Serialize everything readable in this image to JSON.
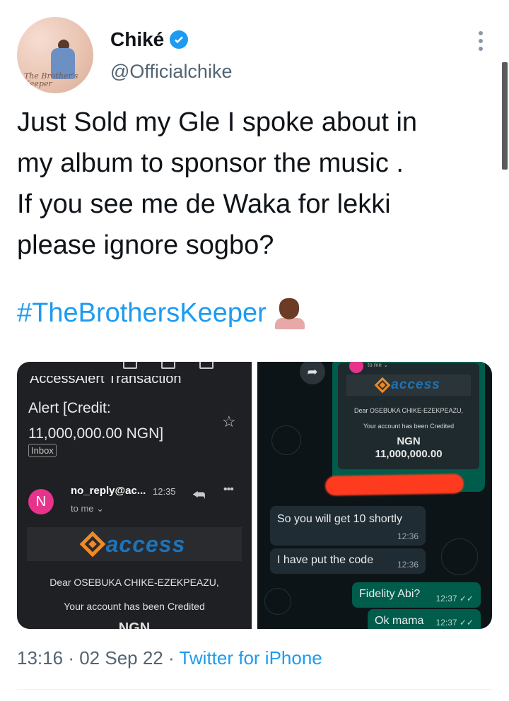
{
  "user": {
    "name": "Chiké",
    "handle": "@Officialchike",
    "avatar_caption": "The Brother's Keeper"
  },
  "tweet": {
    "lines": [
      "Just Sold my Gle I spoke about in",
      "my album to sponsor the music .",
      "If you see me de Waka for lekki",
      "please ignore sogbo?"
    ],
    "hashtag": "#TheBrothersKeeper",
    "time": "13:16",
    "date": "02 Sep 22",
    "source": "Twitter for iPhone",
    "separator": "·"
  },
  "email_screenshot": {
    "header_cut": "AccessAlert Transaction",
    "alert_line1": "Alert [Credit:",
    "alert_line2": "11,000,000.00 NGN]",
    "inbox_label": "Inbox",
    "sender_initial": "N",
    "sender": "no_reply@ac...",
    "time": "12:35",
    "to_me": "to me ⌄",
    "bank": "access",
    "dear": "Dear OSEBUKA CHIKE-EZEKPEAZU,",
    "credited": "Your account has been Credited",
    "currency_cut": "NGN"
  },
  "chat_screenshot": {
    "to_me": "to me ⌄",
    "bank": "access",
    "dear": "Dear OSEBUKA CHIKE-EZEKPEAZU,",
    "credited": "Your account has been Credited",
    "currency": "NGN",
    "amount": "11,000,000.00",
    "messages": [
      {
        "text": "So you will get 10 shortly",
        "time": "12:36",
        "dir": "in"
      },
      {
        "text": "I have put the code",
        "time": "12:36",
        "dir": "in"
      },
      {
        "text": "Fidelity Abi?",
        "time": "12:37 ✓✓",
        "dir": "out"
      },
      {
        "text": "Ok mama",
        "time": "12:37 ✓✓",
        "dir": "out"
      }
    ]
  },
  "colors": {
    "accent": "#1d9bf0",
    "brand_orange": "#f08a24",
    "brand_blue": "#1e73b8",
    "redaction": "#ff3b1f"
  },
  "icons": [
    "verified-badge-icon",
    "more-options-icon",
    "star-icon",
    "reply-icon",
    "share-icon"
  ]
}
